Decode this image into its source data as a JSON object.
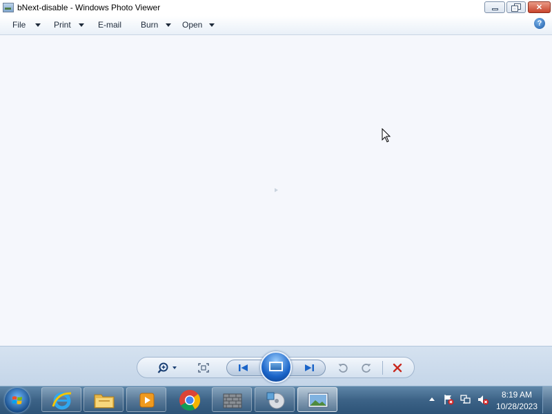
{
  "window": {
    "title": "bNext-disable - Windows Photo Viewer",
    "app_icon": "photo-viewer-icon",
    "controls": {
      "minimize": "minimize-icon",
      "maximize": "restore-icon",
      "close_glyph": "✕"
    }
  },
  "menu": {
    "items": [
      {
        "label": "File",
        "has_dropdown": true
      },
      {
        "label": "Print",
        "has_dropdown": true
      },
      {
        "label": "E-mail",
        "has_dropdown": false
      },
      {
        "label": "Burn",
        "has_dropdown": true
      },
      {
        "label": "Open",
        "has_dropdown": true
      }
    ],
    "help_glyph": "?"
  },
  "controls_bar": {
    "buttons": [
      "zoom-icon",
      "actual-size-icon",
      "previous-icon",
      "slideshow-icon",
      "next-icon",
      "rotate-counterclockwise-icon",
      "rotate-clockwise-icon",
      "delete-icon"
    ],
    "colors": {
      "nav_blue": "#1a64c8",
      "delete_red": "#c8281e"
    }
  },
  "taskbar": {
    "start": "start-orb-icon",
    "apps": [
      "internet-explorer-icon",
      "file-explorer-icon",
      "media-player-icon",
      "chrome-icon",
      "firewall-icon",
      "dvd-maker-icon",
      "photo-viewer-icon"
    ],
    "tray": [
      "show-hidden-icons-icon",
      "action-center-flag-icon",
      "network-icon",
      "volume-muted-icon"
    ],
    "clock": {
      "time": "8:19 AM",
      "date": "10/28/2023"
    }
  }
}
